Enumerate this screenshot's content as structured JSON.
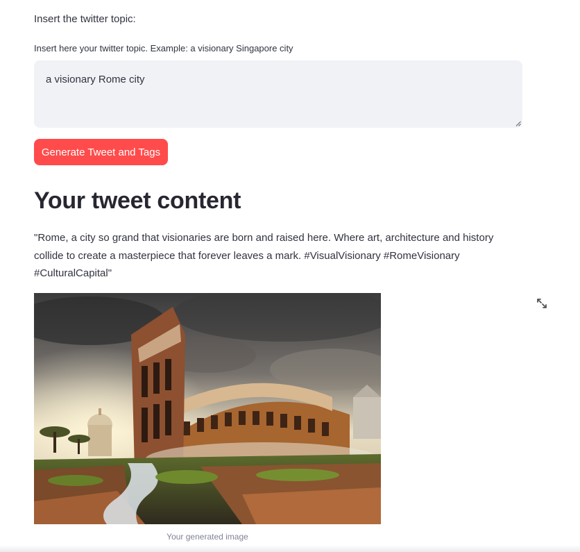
{
  "form": {
    "section_label": "Insert the twitter topic:",
    "input_label": "Insert here your twitter topic. Example: a visionary Singapore city",
    "input_value": "a visionary Rome city",
    "button_label": "Generate Tweet and Tags"
  },
  "result": {
    "heading": "Your tweet content",
    "tweet_text": "\"Rome, a city so grand that visionaries are born and raised here. Where art, architecture and history collide to create a masterpiece that forever leaves a mark. #VisualVisionary #RomeVisionary #CulturalCapital\"",
    "image_caption": "Your generated image"
  },
  "icons": {
    "fullscreen": "expand-arrows-icon",
    "resize": "resize-grip-icon"
  },
  "colors": {
    "primary_button": "#ff4b4b",
    "input_background": "#f0f2f6",
    "text": "#31333f",
    "caption": "#808495"
  }
}
